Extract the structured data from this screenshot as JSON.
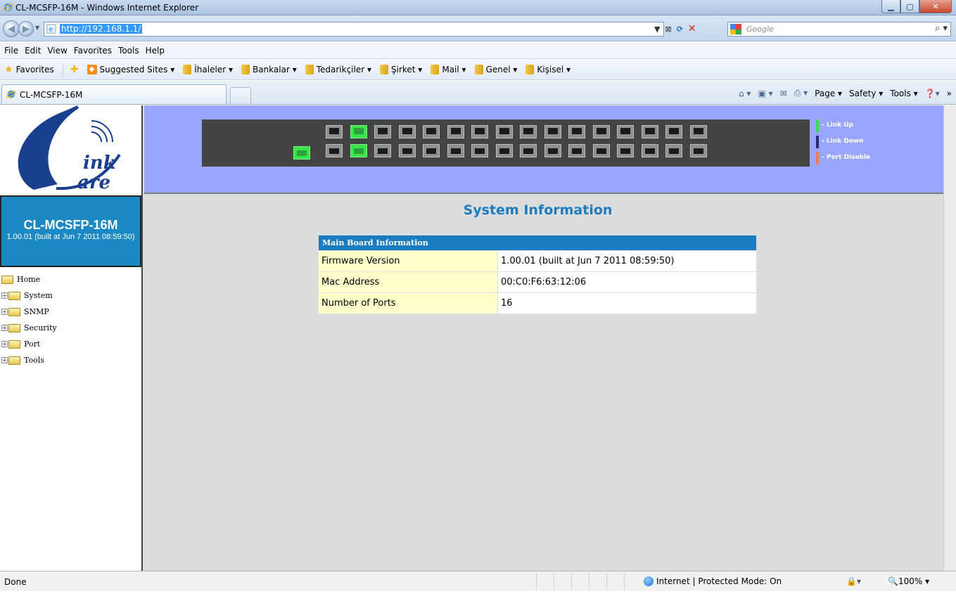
{
  "window": {
    "title": "CL-MCSFP-16M - Windows Internet Explorer",
    "controls": [
      "minimize",
      "maximize",
      "close"
    ]
  },
  "address_bar": {
    "url": "http://192.168.1.1/",
    "search_placeholder": "Google"
  },
  "menu": [
    "File",
    "Edit",
    "View",
    "Favorites",
    "Tools",
    "Help"
  ],
  "favorites_bar": {
    "favorites_label": "Favorites",
    "items": [
      "Suggested Sites ▾",
      "İhaleler ▾",
      "Bankalar ▾",
      "Tedarikçiler ▾",
      "Şirket ▾",
      "Mail ▾",
      "Genel ▾",
      "Kişisel ▾"
    ]
  },
  "tab": {
    "label": "CL-MCSFP-16M"
  },
  "command_bar": {
    "page": "Page ▾",
    "safety": "Safety ▾",
    "tools": "Tools ▾"
  },
  "device": {
    "model": "CL-MCSFP-16M",
    "version": "1.00.01 (built at Jun 7 2011 08:59:50)"
  },
  "ports": {
    "upper_row_up": [
      2
    ],
    "lower_row_up": [
      2
    ],
    "sfp_port_up": true
  },
  "legend": {
    "items": [
      {
        "label": "- Link Up",
        "color": "#33e04a"
      },
      {
        "label": "- Link Down",
        "color": "#2a2a66"
      },
      {
        "label": "- Port Disable",
        "color": "#f07b5c"
      }
    ]
  },
  "nav_tree": [
    "Home",
    "System",
    "SNMP",
    "Security",
    "Port",
    "Tools"
  ],
  "main": {
    "title": "System Information",
    "table_header": "Main Board Information",
    "rows": [
      {
        "label": "Firmware Version",
        "value": "1.00.01 (built at Jun 7 2011 08:59:50)"
      },
      {
        "label": "Mac Address",
        "value": "00:C0:F6:63:12:06"
      },
      {
        "label": "Number of Ports",
        "value": "16"
      }
    ]
  },
  "status_bar": {
    "status": "Done",
    "zone": "Internet | Protected Mode: On",
    "zoom": "100%"
  },
  "colors": {
    "banner": "#99a6ff",
    "accent": "#1b7dbf",
    "key_cell": "#ffffcc"
  }
}
